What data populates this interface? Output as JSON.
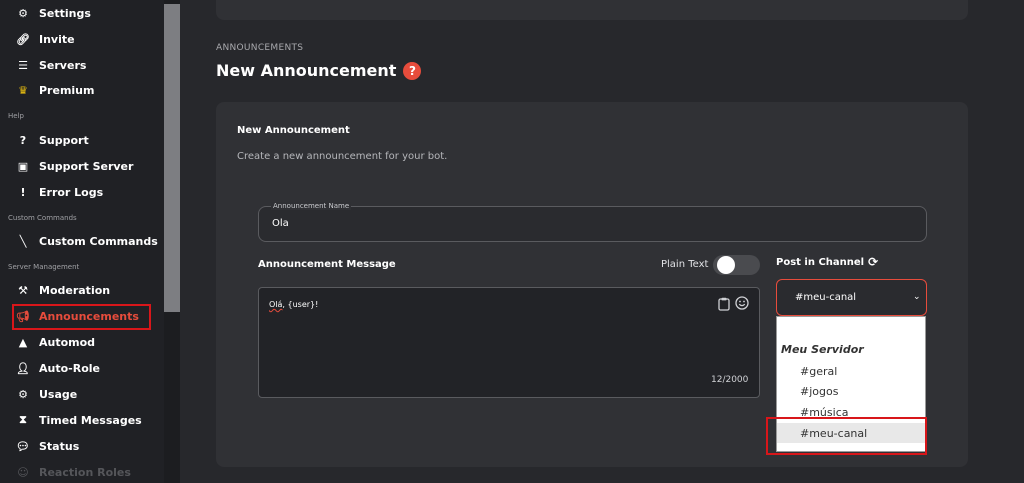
{
  "sidebar": {
    "items_top": [
      {
        "label": "Settings",
        "icon": "gear-icon"
      },
      {
        "label": "Invite",
        "icon": "link-icon"
      },
      {
        "label": "Servers",
        "icon": "servers-icon"
      },
      {
        "label": "Premium",
        "icon": "crown-icon"
      }
    ],
    "section_help": "Help",
    "items_help": [
      {
        "label": "Support",
        "icon": "question-circle-icon"
      },
      {
        "label": "Support Server",
        "icon": "discord-icon"
      },
      {
        "label": "Error Logs",
        "icon": "exclamation-circle-icon"
      }
    ],
    "section_custom": "Custom Commands",
    "items_custom": [
      {
        "label": "Custom Commands",
        "icon": "slash-icon"
      }
    ],
    "section_server": "Server Management",
    "items_server": [
      {
        "label": "Moderation",
        "icon": "hammer-icon"
      },
      {
        "label": "Announcements",
        "icon": "megaphone-icon"
      },
      {
        "label": "Automod",
        "icon": "robot-icon"
      },
      {
        "label": "Auto-Role",
        "icon": "user-plus-icon"
      },
      {
        "label": "Usage",
        "icon": "cogs-icon"
      },
      {
        "label": "Timed Messages",
        "icon": "hourglass-icon"
      },
      {
        "label": "Status",
        "icon": "chat-icon"
      },
      {
        "label": "Reaction Roles",
        "icon": "smile-icon"
      }
    ]
  },
  "main": {
    "breadcrumb": "ANNOUNCEMENTS",
    "title": "New Announcement",
    "card": {
      "title": "New Announcement",
      "description": "Create a new announcement for your bot.",
      "name_label": "Announcement Name",
      "name_value": "Ola",
      "message_label": "Announcement Message",
      "plain_text_label": "Plain Text",
      "message_typo": "Olá",
      "message_rest": ", {user}!",
      "char_count": "12/2000",
      "post_label": "Post in Channel",
      "selected_channel": "#meu-canal",
      "dropdown": {
        "group": "Meu Servidor",
        "options": [
          "#geral",
          "#jogos",
          "#música",
          "#meu-canal"
        ]
      }
    }
  },
  "colors": {
    "accent": "#e74c3c",
    "highlight": "#d8161a"
  }
}
